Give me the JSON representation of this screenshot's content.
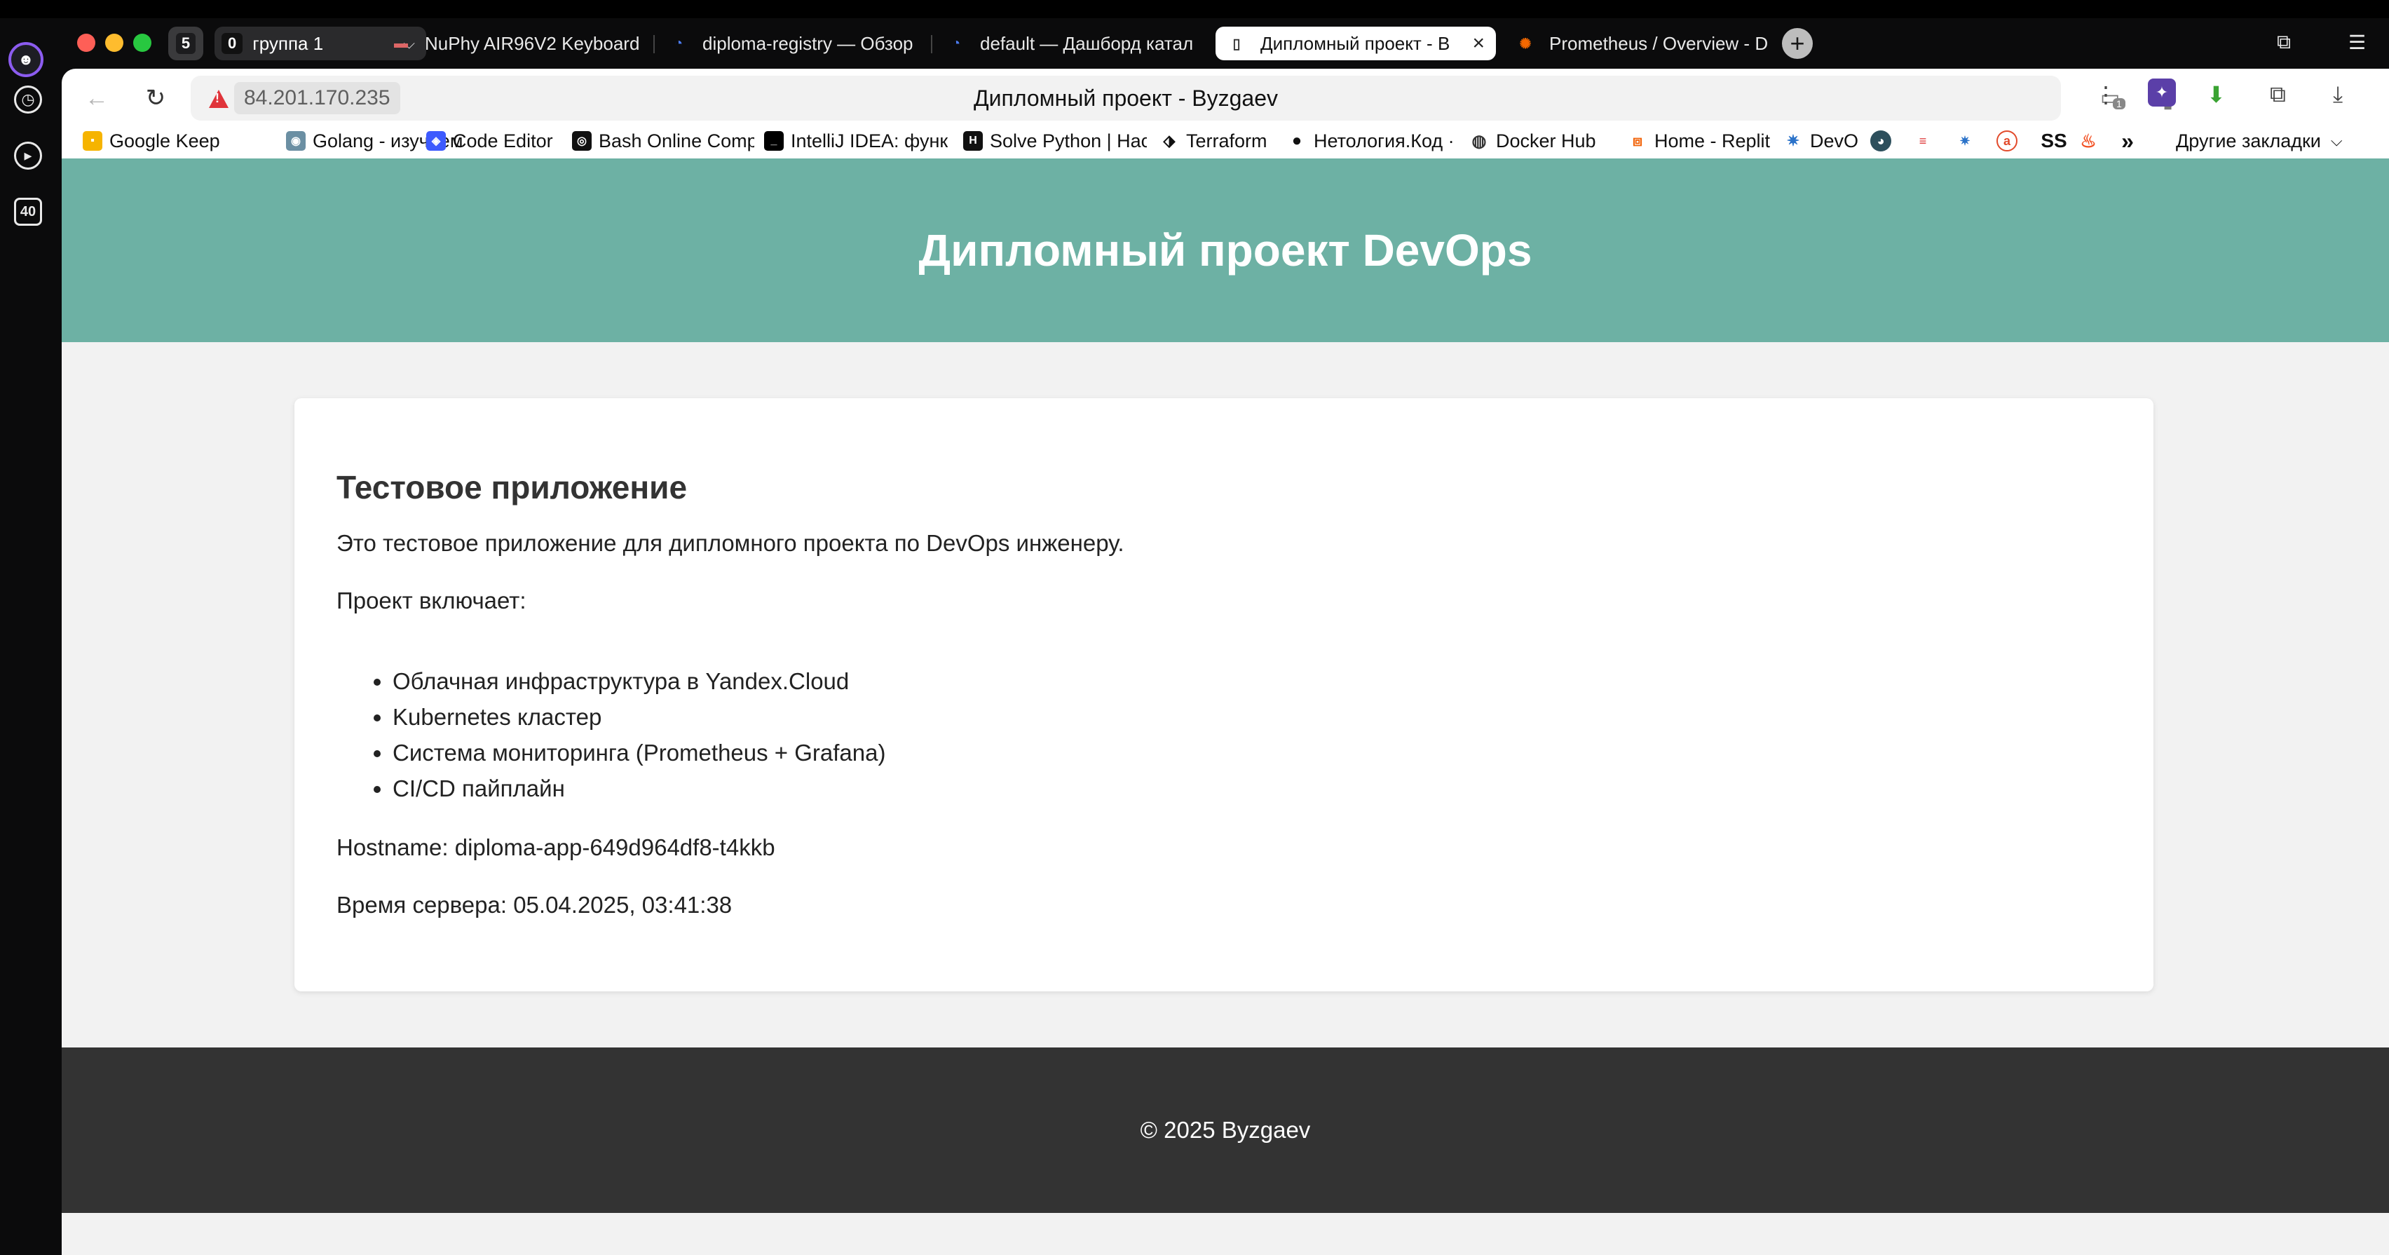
{
  "sidebar": {
    "tabs_badge": "40"
  },
  "tabbar": {
    "tab_count": "5",
    "group": {
      "count": "0",
      "name": "группа 1"
    },
    "tabs": [
      {
        "title": "NuPhy AIR96V2 Keyboard"
      },
      {
        "title": "diploma-registry — Обзор"
      },
      {
        "title": "default — Дашборд катал"
      },
      {
        "title": "Дипломный проект - B"
      },
      {
        "title": "Prometheus / Overview - D"
      }
    ]
  },
  "address_bar": {
    "url": "84.201.170.235",
    "page_title": "Дипломный проект - Byzgaev",
    "extension_badge": "1"
  },
  "bookmarks": {
    "items": [
      {
        "label": "Google Keep"
      },
      {
        "label": "Golang - изучаем"
      },
      {
        "label": "Code Editor"
      },
      {
        "label": "Bash Online Comp"
      },
      {
        "label": "IntelliJ IDEA: функ"
      },
      {
        "label": "Solve Python | Hac"
      },
      {
        "label": "Terraform"
      },
      {
        "label": "Нетология.Код · G"
      },
      {
        "label": "Docker Hub"
      },
      {
        "label": "Home - Replit"
      },
      {
        "label": "DevO"
      }
    ],
    "ss_label": "SS",
    "more_label": "»",
    "other_label": "Другие закладки"
  },
  "page": {
    "header_title": "Дипломный проект DevOps",
    "card": {
      "heading": "Тестовое приложение",
      "intro": "Это тестовое приложение для дипломного проекта по DevOps инженеру.",
      "includes_label": "Проект включает:",
      "features": [
        "Облачная инфраструктура в Yandex.Cloud",
        "Kubernetes кластер",
        "Система мониторинга (Prometheus + Grafana)",
        "CI/CD пайплайн"
      ],
      "hostname": "Hostname: diploma-app-649d964df8-t4kkb",
      "server_time": "Время сервера: 05.04.2025, 03:41:38"
    },
    "footer_text": "© 2025 Byzgaev"
  },
  "colors": {
    "header_bg": "#6db1a4",
    "footer_bg": "#333333",
    "page_bg": "#f2f2f2",
    "warning": "#e0343a"
  }
}
